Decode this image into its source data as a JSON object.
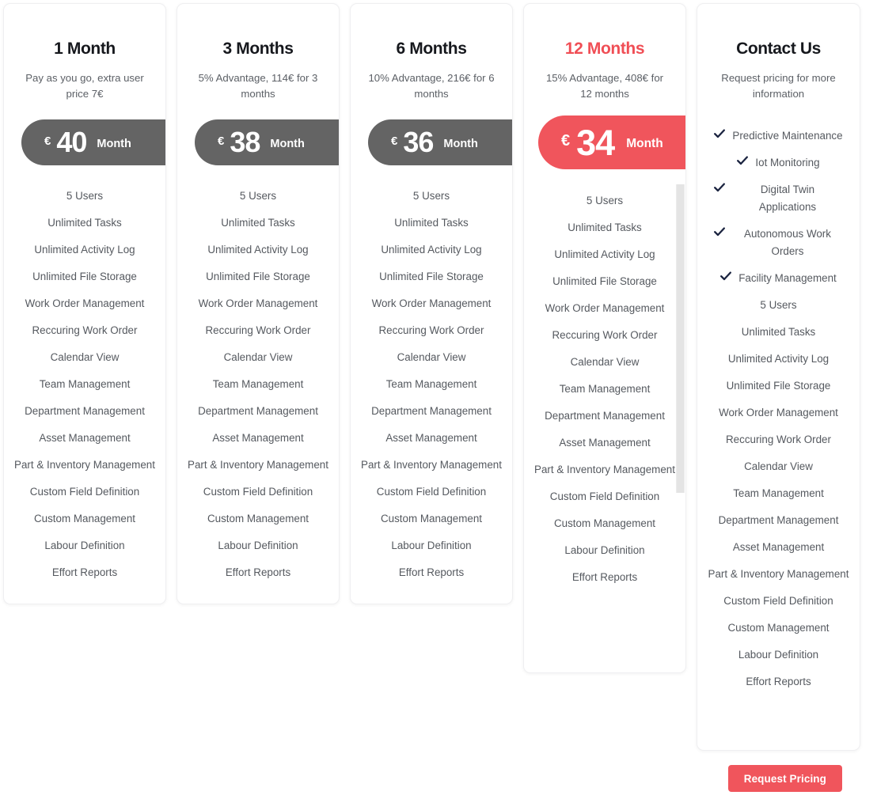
{
  "plans": [
    {
      "id": "1-month",
      "title": "1 Month",
      "subtitle": "Pay as you go, extra user price 7€",
      "currency": "€",
      "amount": "40",
      "period": "Month",
      "highlight": false,
      "features": [
        "5 Users",
        "Unlimited Tasks",
        "Unlimited Activity Log",
        "Unlimited File Storage",
        "Work Order Management",
        "Reccuring Work Order",
        "Calendar View",
        "Team Management",
        "Department Management",
        "Asset Management",
        "Part & Inventory Management",
        "Custom Field Definition",
        "Custom Management",
        "Labour Definition",
        "Effort Reports"
      ]
    },
    {
      "id": "3-months",
      "title": "3 Months",
      "subtitle": "5% Advantage, 114€ for 3 months",
      "currency": "€",
      "amount": "38",
      "period": "Month",
      "highlight": false,
      "features": [
        "5 Users",
        "Unlimited Tasks",
        "Unlimited Activity Log",
        "Unlimited File Storage",
        "Work Order Management",
        "Reccuring Work Order",
        "Calendar View",
        "Team Management",
        "Department Management",
        "Asset Management",
        "Part & Inventory Management",
        "Custom Field Definition",
        "Custom Management",
        "Labour Definition",
        "Effort Reports"
      ]
    },
    {
      "id": "6-months",
      "title": "6 Months",
      "subtitle": "10% Advantage, 216€ for 6 months",
      "currency": "€",
      "amount": "36",
      "period": "Month",
      "highlight": false,
      "features": [
        "5 Users",
        "Unlimited Tasks",
        "Unlimited Activity Log",
        "Unlimited File Storage",
        "Work Order Management",
        "Reccuring Work Order",
        "Calendar View",
        "Team Management",
        "Department Management",
        "Asset Management",
        "Part & Inventory Management",
        "Custom Field Definition",
        "Custom Management",
        "Labour Definition",
        "Effort Reports"
      ]
    },
    {
      "id": "12-months",
      "title": "12 Months",
      "subtitle": "15% Advantage, 408€ for 12 months",
      "currency": "€",
      "amount": "34",
      "period": "Month",
      "highlight": true,
      "features": [
        "5 Users",
        "Unlimited Tasks",
        "Unlimited Activity Log",
        "Unlimited File Storage",
        "Work Order Management",
        "Reccuring Work Order",
        "Calendar View",
        "Team Management",
        "Department Management",
        "Asset Management",
        "Part & Inventory Management",
        "Custom Field Definition",
        "Custom Management",
        "Labour Definition",
        "Effort Reports"
      ]
    }
  ],
  "contact": {
    "id": "contact-us",
    "title": "Contact Us",
    "subtitle": "Request pricing for more information",
    "checked_features": [
      "Predictive Maintenance",
      "Iot Monitoring",
      "Digital Twin Applications",
      "Autonomous Work Orders",
      "Facility Management"
    ],
    "features": [
      "5 Users",
      "Unlimited Tasks",
      "Unlimited Activity Log",
      "Unlimited File Storage",
      "Work Order Management",
      "Reccuring Work Order",
      "Calendar View",
      "Team Management",
      "Department Management",
      "Asset Management",
      "Part & Inventory Management",
      "Custom Field Definition",
      "Custom Management",
      "Labour Definition",
      "Effort Reports"
    ]
  },
  "cta": {
    "label": "Request Pricing"
  },
  "colors": {
    "accent": "#f0555c",
    "price_pill": "#646464",
    "check": "#1b2440",
    "text": "#55595f",
    "title": "#16181d"
  },
  "icons": {
    "check": "check-icon"
  }
}
